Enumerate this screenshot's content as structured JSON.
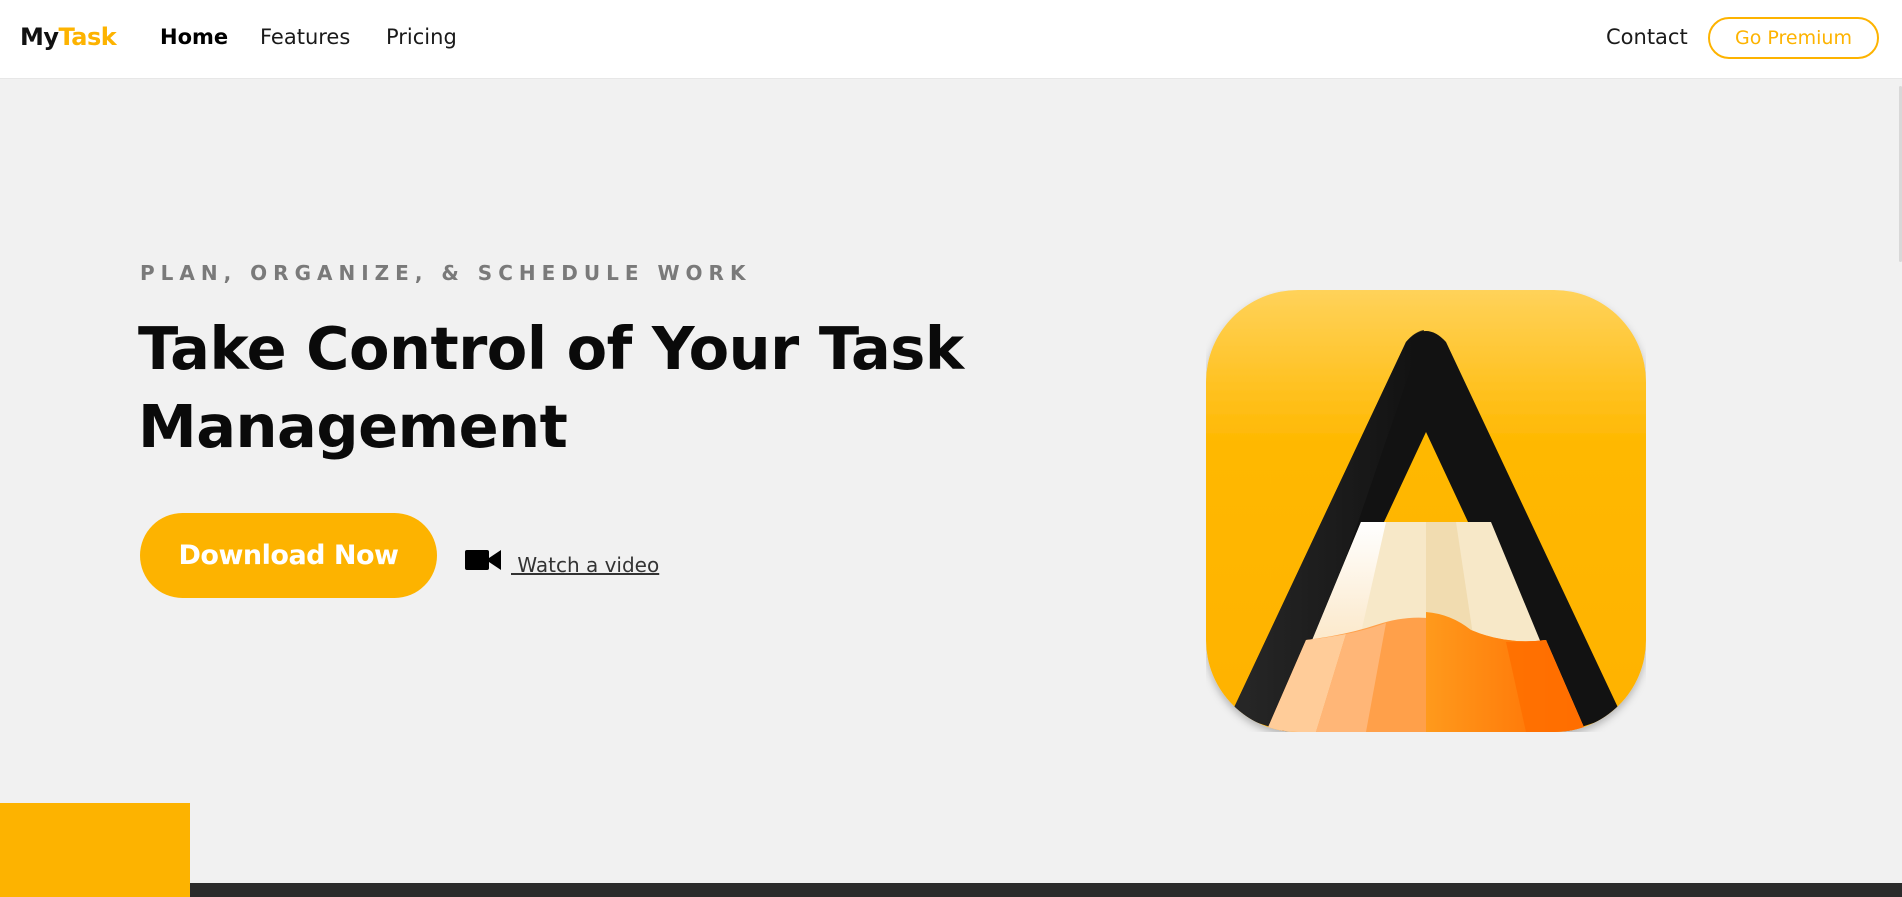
{
  "nav": {
    "logo_part1": "My",
    "logo_part2": "Task",
    "links": [
      "Home",
      "Features",
      "Pricing"
    ],
    "contact": "Contact",
    "premium_button": "Go Premium"
  },
  "hero": {
    "eyebrow": "PLAN, ORGANIZE, & SCHEDULE WORK",
    "title": "Take Control of Your Task Management",
    "download_button": "Download Now",
    "video_link": " Watch a video",
    "video_icon": "video-camera-icon",
    "app_icon": "pencil-app-icon"
  },
  "colors": {
    "accent": "#fdb300",
    "background": "#f1f1f1",
    "dark": "#2b2b2b"
  }
}
